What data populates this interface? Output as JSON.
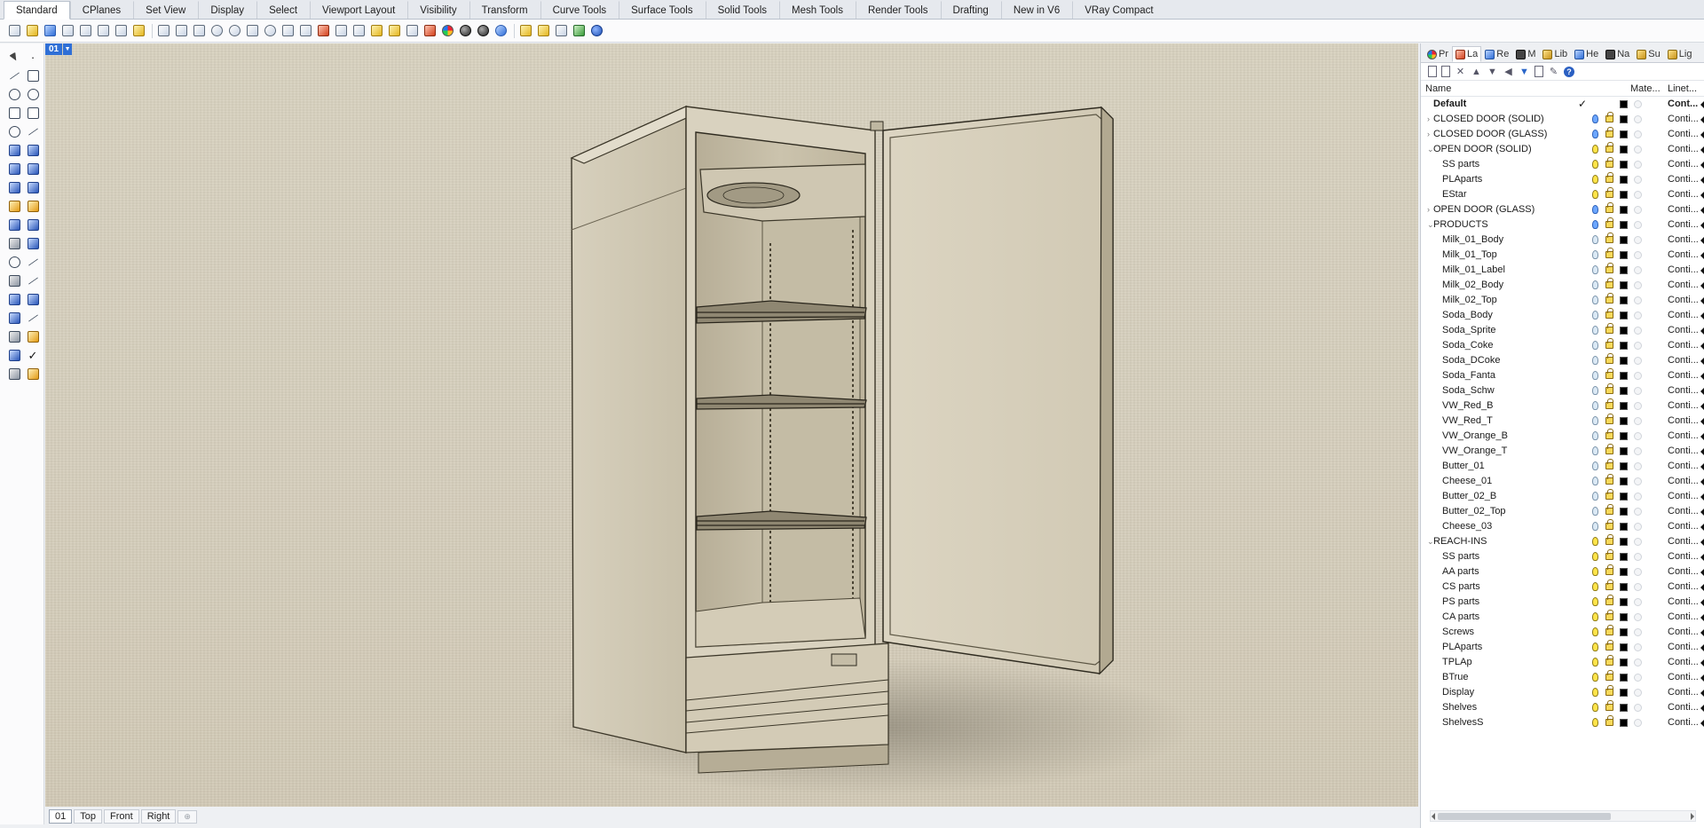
{
  "tabs": [
    "Standard",
    "CPlanes",
    "Set View",
    "Display",
    "Select",
    "Viewport Layout",
    "Visibility",
    "Transform",
    "Curve Tools",
    "Surface Tools",
    "Solid Tools",
    "Mesh Tools",
    "Render Tools",
    "Drafting",
    "New in V6",
    "VRay Compact"
  ],
  "active_tab": "Standard",
  "viewport": {
    "name": "01",
    "bottom_tabs": [
      "01",
      "Top",
      "Front",
      "Right"
    ],
    "active_bottom_tab": "01",
    "add_tab_icon": "⊕"
  },
  "panel": {
    "tabs": [
      {
        "label": "Pr",
        "icon": "rainbow"
      },
      {
        "label": "La",
        "icon": "red"
      },
      {
        "label": "Re",
        "icon": "blue"
      },
      {
        "label": "M",
        "icon": "dark"
      },
      {
        "label": "Lib",
        "icon": "folder"
      },
      {
        "label": "He",
        "icon": "blue"
      },
      {
        "label": "Na",
        "icon": "dark"
      },
      {
        "label": "Su",
        "icon": "folder"
      },
      {
        "label": "Lig",
        "icon": "folder"
      }
    ],
    "columns": {
      "name": "Name",
      "material": "Mate...",
      "linetype": "Linet..."
    }
  },
  "layers": [
    {
      "name": "Default",
      "level": 0,
      "bold": true,
      "current": true,
      "bulb": "none",
      "linetype": "Cont..."
    },
    {
      "name": "CLOSED DOOR (SOLID)",
      "level": 0,
      "expand": "collapsed",
      "bulb": "blue",
      "linetype": "Conti..."
    },
    {
      "name": "CLOSED DOOR (GLASS)",
      "level": 0,
      "expand": "collapsed",
      "bulb": "blue",
      "linetype": "Conti..."
    },
    {
      "name": "OPEN DOOR (SOLID)",
      "level": 0,
      "expand": "expanded",
      "bulb": "on",
      "linetype": "Conti..."
    },
    {
      "name": "SS parts",
      "level": 1,
      "bulb": "on",
      "linetype": "Conti..."
    },
    {
      "name": "PLAparts",
      "level": 1,
      "bulb": "on",
      "linetype": "Conti..."
    },
    {
      "name": "EStar",
      "level": 1,
      "bulb": "on",
      "linetype": "Conti..."
    },
    {
      "name": "OPEN DOOR (GLASS)",
      "level": 0,
      "expand": "collapsed",
      "bulb": "blue",
      "linetype": "Conti..."
    },
    {
      "name": "PRODUCTS",
      "level": 0,
      "expand": "expanded",
      "bulb": "blue",
      "linetype": "Conti..."
    },
    {
      "name": "Milk_01_Body",
      "level": 1,
      "bulb": "off",
      "linetype": "Conti..."
    },
    {
      "name": "Milk_01_Top",
      "level": 1,
      "bulb": "off",
      "linetype": "Conti..."
    },
    {
      "name": "Milk_01_Label",
      "level": 1,
      "bulb": "off",
      "linetype": "Conti..."
    },
    {
      "name": "Milk_02_Body",
      "level": 1,
      "bulb": "off",
      "linetype": "Conti..."
    },
    {
      "name": "Milk_02_Top",
      "level": 1,
      "bulb": "off",
      "linetype": "Conti..."
    },
    {
      "name": "Soda_Body",
      "level": 1,
      "bulb": "off",
      "linetype": "Conti..."
    },
    {
      "name": "Soda_Sprite",
      "level": 1,
      "bulb": "off",
      "linetype": "Conti..."
    },
    {
      "name": "Soda_Coke",
      "level": 1,
      "bulb": "off",
      "linetype": "Conti..."
    },
    {
      "name": "Soda_DCoke",
      "level": 1,
      "bulb": "off",
      "linetype": "Conti..."
    },
    {
      "name": "Soda_Fanta",
      "level": 1,
      "bulb": "off",
      "linetype": "Conti..."
    },
    {
      "name": "Soda_Schw",
      "level": 1,
      "bulb": "off",
      "linetype": "Conti..."
    },
    {
      "name": "VW_Red_B",
      "level": 1,
      "bulb": "off",
      "linetype": "Conti..."
    },
    {
      "name": "VW_Red_T",
      "level": 1,
      "bulb": "off",
      "linetype": "Conti..."
    },
    {
      "name": "VW_Orange_B",
      "level": 1,
      "bulb": "off",
      "linetype": "Conti..."
    },
    {
      "name": "VW_Orange_T",
      "level": 1,
      "bulb": "off",
      "linetype": "Conti..."
    },
    {
      "name": "Butter_01",
      "level": 1,
      "bulb": "off",
      "linetype": "Conti..."
    },
    {
      "name": "Cheese_01",
      "level": 1,
      "bulb": "off",
      "linetype": "Conti..."
    },
    {
      "name": "Butter_02_B",
      "level": 1,
      "bulb": "off",
      "linetype": "Conti..."
    },
    {
      "name": "Butter_02_Top",
      "level": 1,
      "bulb": "off",
      "linetype": "Conti..."
    },
    {
      "name": "Cheese_03",
      "level": 1,
      "bulb": "off",
      "linetype": "Conti..."
    },
    {
      "name": "REACH-INS",
      "level": 0,
      "expand": "expanded",
      "bulb": "on",
      "linetype": "Conti..."
    },
    {
      "name": "SS parts",
      "level": 1,
      "bulb": "on",
      "linetype": "Conti..."
    },
    {
      "name": "AA parts",
      "level": 1,
      "bulb": "on",
      "linetype": "Conti..."
    },
    {
      "name": "CS parts",
      "level": 1,
      "bulb": "on",
      "linetype": "Conti..."
    },
    {
      "name": "PS parts",
      "level": 1,
      "bulb": "on",
      "linetype": "Conti..."
    },
    {
      "name": "CA parts",
      "level": 1,
      "bulb": "on",
      "linetype": "Conti..."
    },
    {
      "name": "Screws",
      "level": 1,
      "bulb": "on",
      "linetype": "Conti..."
    },
    {
      "name": "PLAparts",
      "level": 1,
      "bulb": "on",
      "linetype": "Conti..."
    },
    {
      "name": "TPLAp",
      "level": 1,
      "bulb": "on",
      "linetype": "Conti..."
    },
    {
      "name": "BTrue",
      "level": 1,
      "bulb": "on",
      "linetype": "Conti..."
    },
    {
      "name": "Display",
      "level": 1,
      "bulb": "on",
      "linetype": "Conti..."
    },
    {
      "name": "Shelves",
      "level": 1,
      "bulb": "on",
      "linetype": "Conti..."
    },
    {
      "name": "ShelvesS",
      "level": 1,
      "bulb": "on",
      "linetype": "Conti..."
    }
  ],
  "colors": {
    "accent": "#2f6fd6",
    "viewport_background": "#d6cfbd",
    "layer_color": "#000000"
  }
}
